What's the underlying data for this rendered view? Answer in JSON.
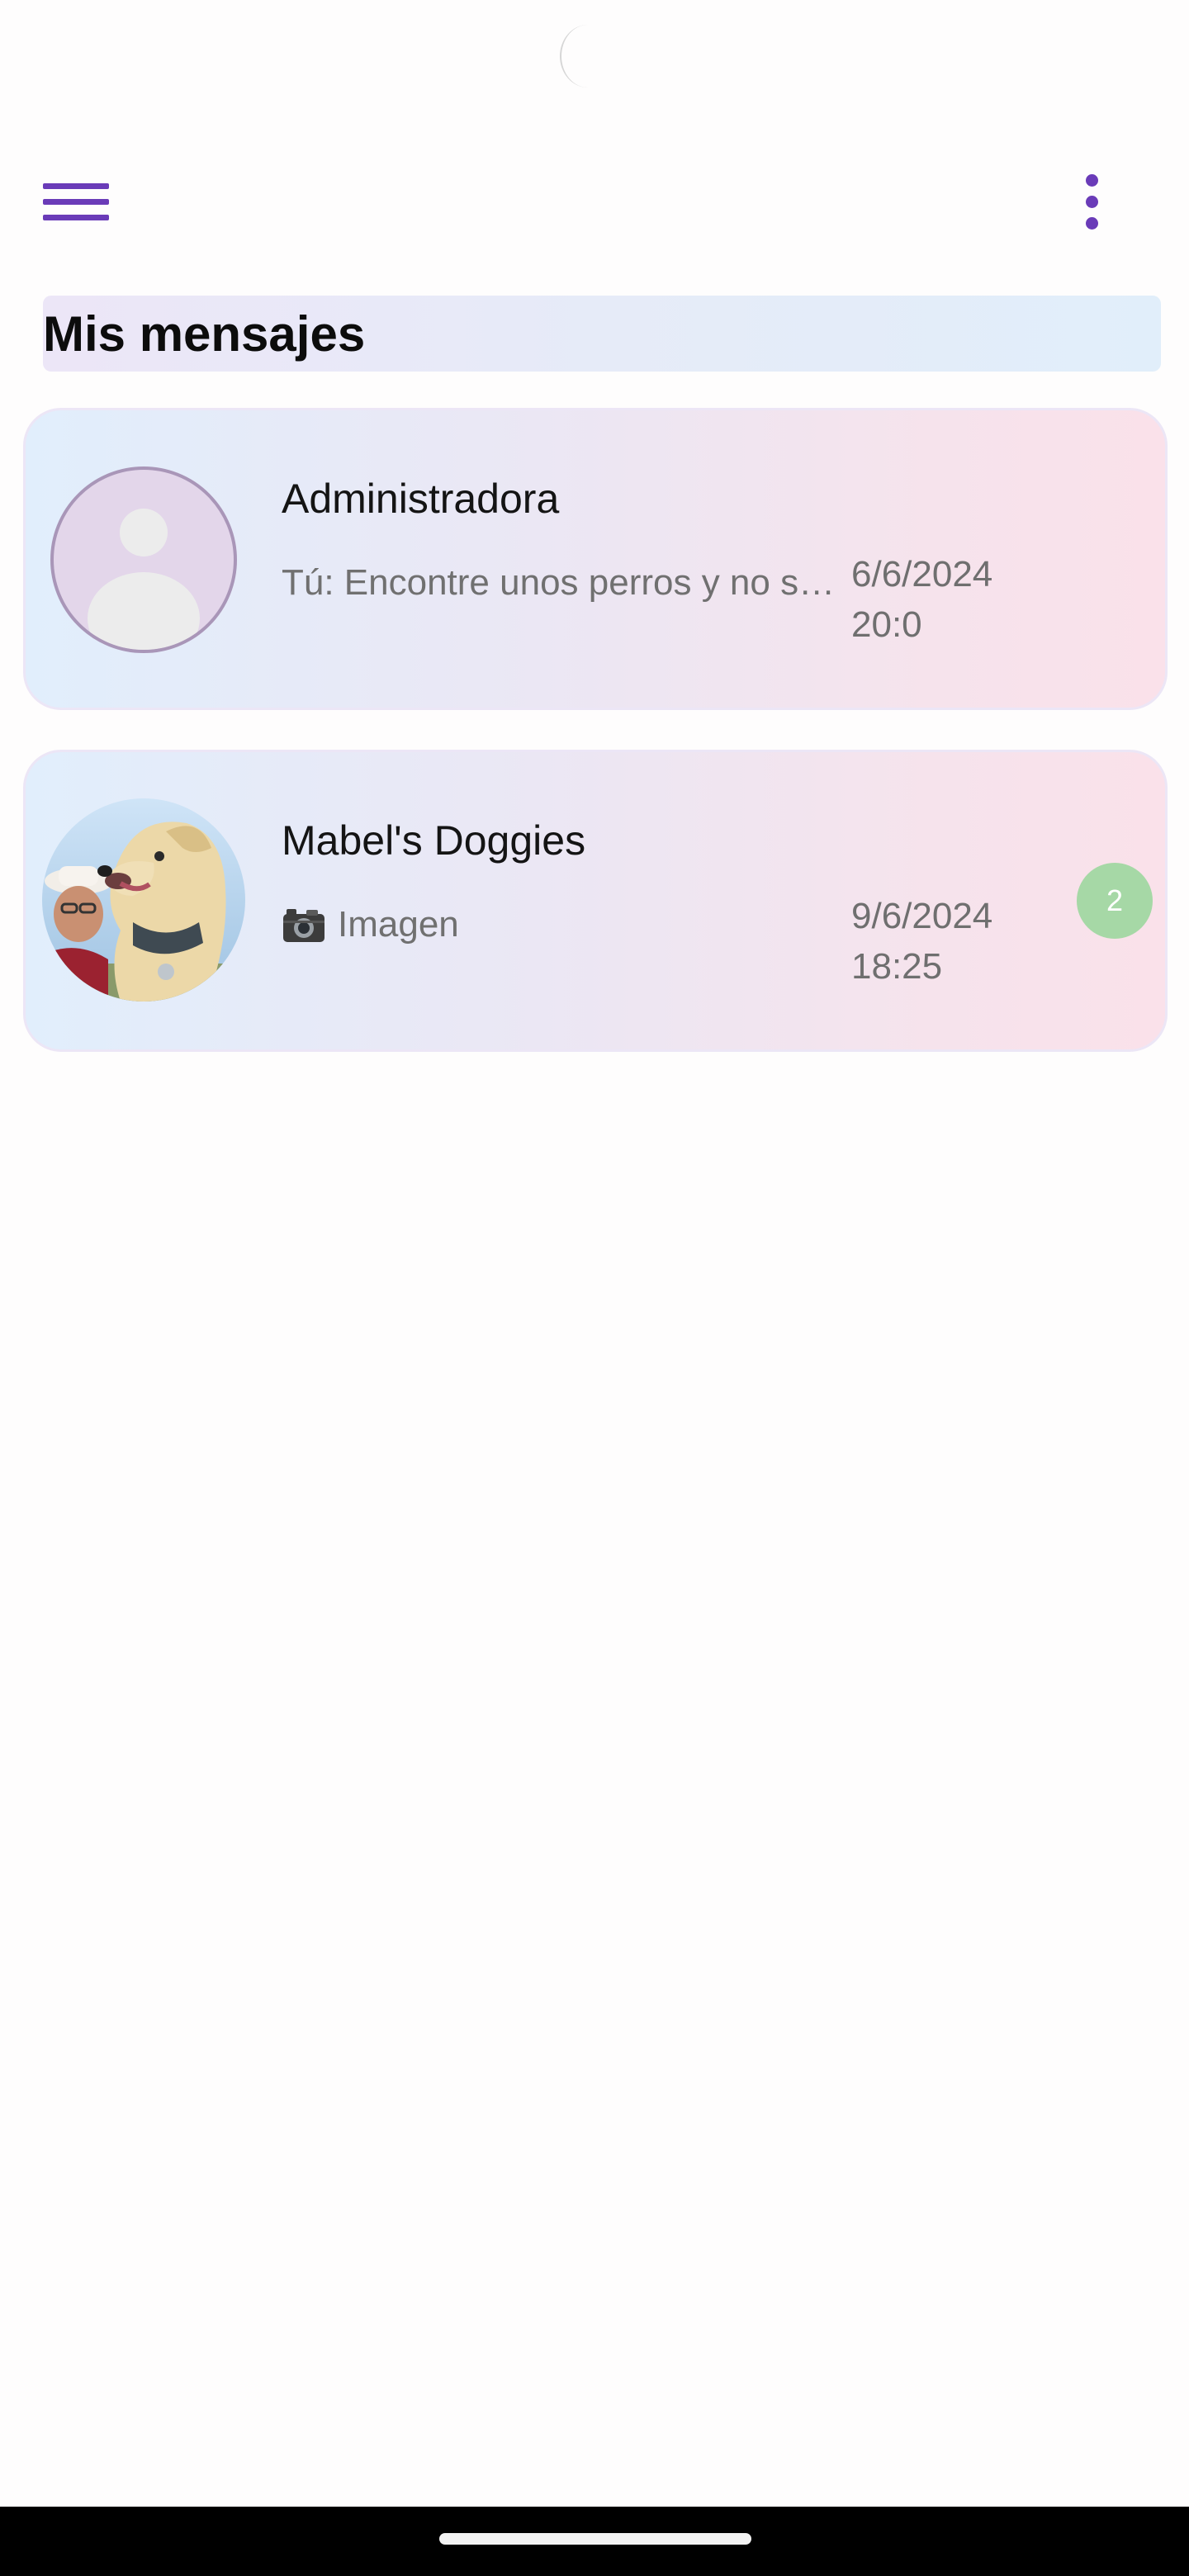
{
  "header": {
    "menu_icon": "hamburger-menu-icon",
    "more_icon": "more-vert-icon",
    "accent_color": "#6a3bb8"
  },
  "page": {
    "title": "Mis mensajes"
  },
  "conversations": [
    {
      "name": "Administradora",
      "preview": "Tú: Encontre unos perros y no s…",
      "date": "6/6/2024",
      "time": "20:0",
      "avatar": "default-user-avatar-icon",
      "unread": null
    },
    {
      "name": "Mabel's Doggies",
      "preview_icon": "camera-icon",
      "preview": "Imagen",
      "date": "9/6/2024",
      "time": "18:25",
      "avatar": "dog-profile-photo",
      "unread": "2"
    }
  ],
  "colors": {
    "badge": "#a6d8a6",
    "card_gradient_start": "#e1eefc",
    "card_gradient_end": "#fae1ea"
  }
}
